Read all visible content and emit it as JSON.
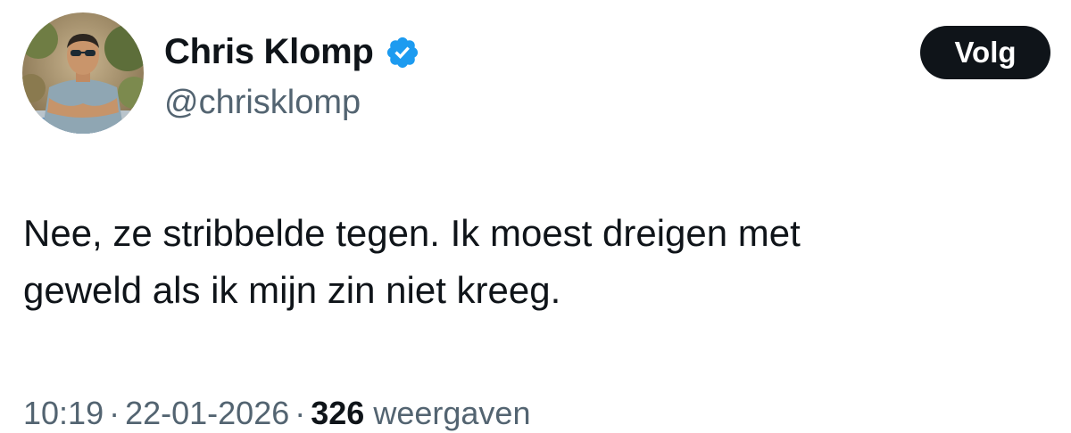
{
  "tweet": {
    "author": {
      "display_name": "Chris Klomp",
      "handle": "@chrisklomp",
      "verified": true,
      "verified_badge_icon": "verified-badge-icon",
      "verified_color": "#1d9bf0",
      "avatar_icon": "profile-photo"
    },
    "follow_button_label": "Volg",
    "text_lines": [
      "Nee, ze stribbelde tegen. Ik moest dreigen met",
      "geweld als ik mijn zin niet kreeg."
    ],
    "meta": {
      "time": "10:19",
      "separator": "·",
      "date": "22-01-2026",
      "views_count": "326",
      "views_label": "weergaven"
    }
  },
  "colors": {
    "text_primary": "#0f1419",
    "text_secondary": "#536471",
    "button_background": "#0f1419",
    "button_text": "#ffffff",
    "background": "#ffffff"
  }
}
